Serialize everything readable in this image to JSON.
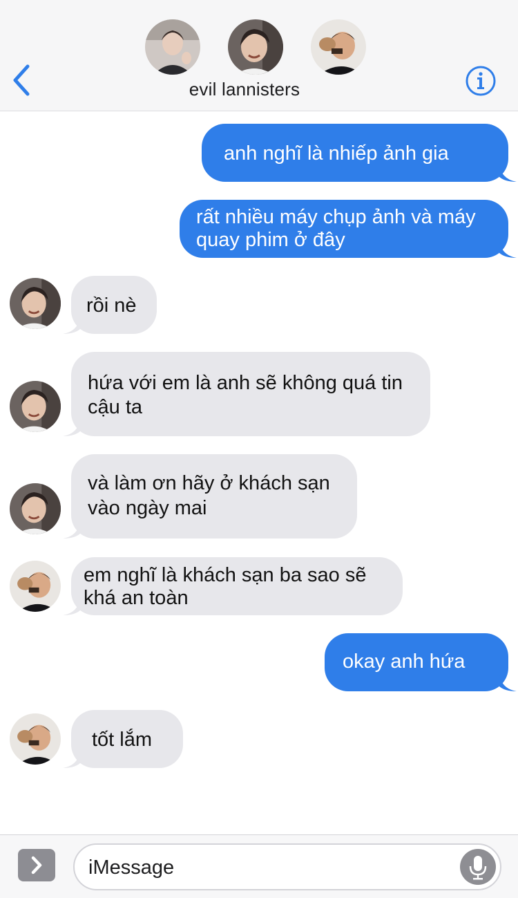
{
  "header": {
    "group_name": "evil lannisters",
    "participants": [
      {
        "name": "participant-1",
        "icon": "avatar-photo"
      },
      {
        "name": "participant-2",
        "icon": "avatar-photo"
      },
      {
        "name": "participant-3",
        "icon": "avatar-photo"
      }
    ],
    "back_icon": "chevron-left-icon",
    "info_icon": "info-icon",
    "accent_color": "#2f7ee9"
  },
  "messages": [
    {
      "direction": "outgoing",
      "text": "anh nghĩ là nhiếp ảnh gia"
    },
    {
      "direction": "outgoing",
      "text": "rất nhiều máy chụp ảnh và máy quay phim ở đây"
    },
    {
      "direction": "incoming",
      "sender": "participant-2",
      "text": "rồi nè"
    },
    {
      "direction": "incoming",
      "sender": "participant-2",
      "text": "hứa với em là anh sẽ không quá tin cậu ta"
    },
    {
      "direction": "incoming",
      "sender": "participant-2",
      "text": "và làm ơn hãy ở khách sạn vào ngày mai"
    },
    {
      "direction": "incoming",
      "sender": "participant-3",
      "text": "em nghĩ là khách sạn ba sao sẽ khá an toàn"
    },
    {
      "direction": "outgoing",
      "text": "okay anh hứa"
    },
    {
      "direction": "incoming",
      "sender": "participant-3",
      "text": "tốt lắm"
    }
  ],
  "composer": {
    "placeholder": "iMessage",
    "apps_icon": "chevron-right-icon",
    "mic_icon": "microphone-icon"
  },
  "colors": {
    "outgoing_bubble": "#2f7ee9",
    "incoming_bubble": "#e7e7eb",
    "header_bg": "#f6f6f7"
  }
}
